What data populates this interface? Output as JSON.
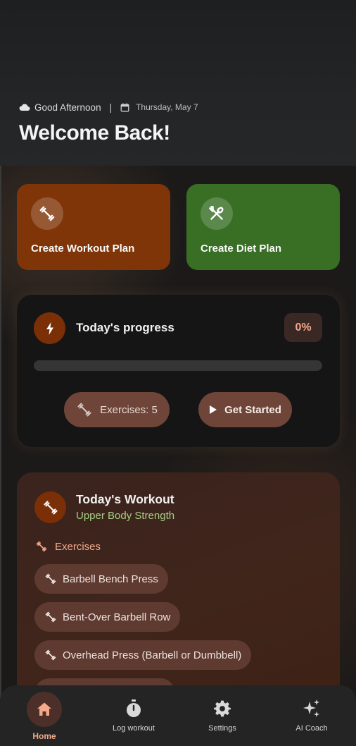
{
  "header": {
    "greeting": "Good Afternoon",
    "separator": "|",
    "date": "Thursday, May 7",
    "title": "Welcome Back!"
  },
  "actions": {
    "workout_label": "Create Workout Plan",
    "diet_label": "Create Diet Plan"
  },
  "progress": {
    "title": "Today's progress",
    "percent_label": "0%",
    "percent_value": 0,
    "exercises_label": "Exercises: 5",
    "start_label": "Get Started"
  },
  "workout": {
    "title": "Today's Workout",
    "subtitle": "Upper Body Strength",
    "exercises_heading": "Exercises",
    "exercises": [
      "Barbell Bench Press",
      "Bent-Over Barbell Row",
      "Overhead Press (Barbell or Dumbbell)"
    ]
  },
  "nav": {
    "home": "Home",
    "log": "Log workout",
    "settings": "Settings",
    "coach": "AI Coach"
  },
  "colors": {
    "accent": "#f4a98b",
    "workout_card": "#7f3508",
    "diet_card": "#386f24",
    "subtitle_green": "#a6cf86"
  }
}
